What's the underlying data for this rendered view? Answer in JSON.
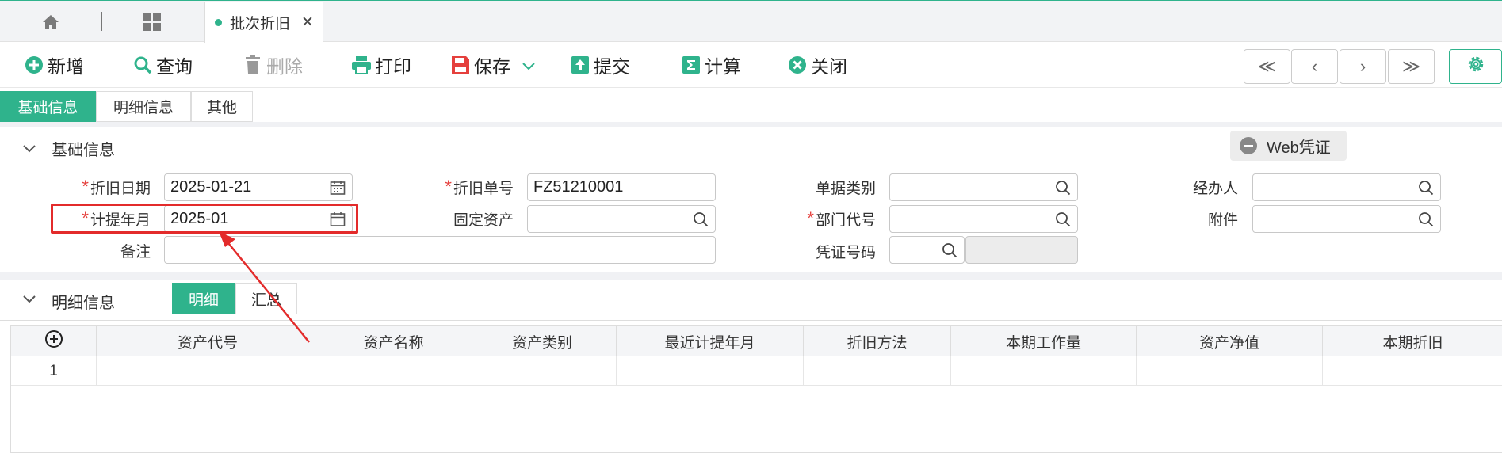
{
  "tabbar": {
    "active_tab": "批次折旧",
    "close_glyph": "✕",
    "accent": "#2fb38c"
  },
  "toolbar": {
    "add": "新增",
    "query": "查询",
    "delete": "删除",
    "print": "打印",
    "save": "保存",
    "submit": "提交",
    "calculate": "计算",
    "close": "关闭",
    "nav": {
      "first": "≪",
      "prev": "‹",
      "next": "›",
      "last": "≫"
    }
  },
  "section_tabs": [
    "基础信息",
    "明细信息",
    "其他"
  ],
  "basic": {
    "title": "基础信息",
    "web_voucher": "Web凭证",
    "fields": {
      "depr_date": {
        "label": "折旧日期",
        "value": "2025-01-21",
        "required": true
      },
      "depr_no": {
        "label": "折旧单号",
        "value": "FZ51210001",
        "required": true
      },
      "doc_type": {
        "label": "单据类别",
        "value": ""
      },
      "handler": {
        "label": "经办人",
        "value": ""
      },
      "accrual_month": {
        "label": "计提年月",
        "value": "2025-01",
        "required": true
      },
      "fixed_asset": {
        "label": "固定资产",
        "value": ""
      },
      "dept_code": {
        "label": "部门代号",
        "value": "",
        "required": true
      },
      "attachment": {
        "label": "附件",
        "value": ""
      },
      "remark": {
        "label": "备注",
        "value": ""
      },
      "voucher_no": {
        "label": "凭证号码",
        "value": ""
      }
    },
    "required_mark": "*"
  },
  "detail": {
    "title": "明细信息",
    "tabs": [
      "明细",
      "汇总"
    ],
    "columns": [
      "资产代号",
      "资产名称",
      "资产类别",
      "最近计提年月",
      "折旧方法",
      "本期工作量",
      "资产净值",
      "本期折旧"
    ],
    "rows": [
      {
        "index": "1",
        "cells": [
          "",
          "",
          "",
          "",
          "",
          "",
          "",
          ""
        ]
      }
    ]
  }
}
